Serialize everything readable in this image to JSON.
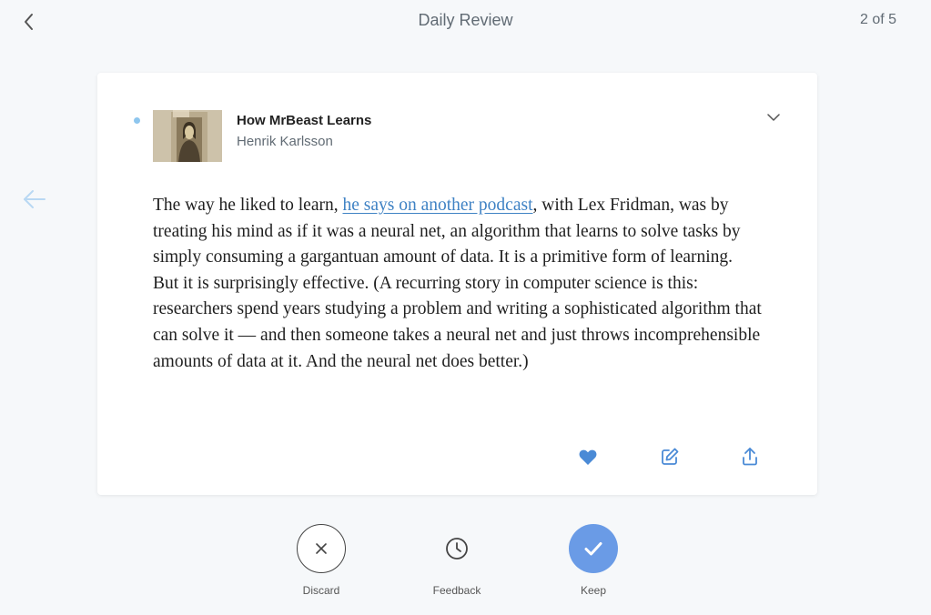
{
  "header": {
    "title": "Daily Review",
    "counter": "2 of 5",
    "back_icon": "chevron-left-icon",
    "prev_icon": "arrow-left-icon"
  },
  "card": {
    "book_title": "How MrBeast Learns",
    "author": "Henrik Karlsson",
    "thumbnail": "mona-lisa-thumbnail",
    "highlight_before_link": "The way he liked to learn, ",
    "highlight_link": "he says on another podcast",
    "highlight_after_link": ", with Lex Fridman, was by treating his mind as if it was a neural net, an algorithm that learns to solve tasks by simply consuming a gargantuan amount of data. It is a primitive form of learning. But it is surprisingly effective. (A recurring story in computer science is this: researchers spend years studying a problem and writing a sophisticated algorithm that can solve it — and then someone takes a neural net and just throws incomprehensible amounts of data at it. And the neural net does better.)",
    "actions": [
      "heart-icon",
      "edit-icon",
      "share-icon"
    ]
  },
  "bottom_actions": {
    "discard": "Discard",
    "feedback": "Feedback",
    "keep": "Keep"
  },
  "colors": {
    "accent": "#3f82c4",
    "keep_button": "#6a9be6",
    "heart": "#4a8ad6",
    "unread_dot": "#8ec6ee",
    "background": "#f6f8fa"
  }
}
